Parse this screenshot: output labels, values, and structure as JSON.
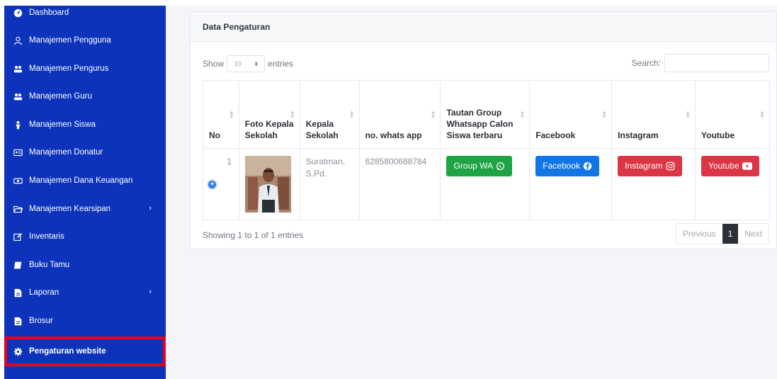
{
  "sidebar": {
    "items": [
      {
        "label": "Dashboard",
        "icon": "dashboard-icon"
      },
      {
        "label": "Manajemen Pengguna",
        "icon": "user-icon"
      },
      {
        "label": "Manajemen Pengurus",
        "icon": "users-icon"
      },
      {
        "label": "Manajemen Guru",
        "icon": "users-icon"
      },
      {
        "label": "Manajemen Siswa",
        "icon": "student-icon"
      },
      {
        "label": "Manajemen Donatur",
        "icon": "id-card-icon"
      },
      {
        "label": "Manajemen Dana Keuangan",
        "icon": "money-icon"
      },
      {
        "label": "Manajemen Kearsipan",
        "icon": "folder-open-icon",
        "chevron": "›"
      },
      {
        "label": "Inventaris",
        "icon": "edit-icon"
      },
      {
        "label": "Buku Tamu",
        "icon": "book-icon"
      },
      {
        "label": "Laporan",
        "icon": "file-icon",
        "chevron": "›"
      },
      {
        "label": "Brosur",
        "icon": "file-icon"
      },
      {
        "label": "Pengaturan website",
        "icon": "gear-icon"
      }
    ],
    "active_index": 12,
    "bg_color": "#0c33b9",
    "highlight_color": "#e8001c"
  },
  "card": {
    "title": "Data Pengaturan"
  },
  "controls": {
    "show_label": "Show",
    "page_length": "10",
    "entries_label": "entries",
    "search_label": "Search:"
  },
  "table": {
    "columns": [
      "No",
      "Foto Kepala Sekolah",
      "Kepala Sekolah",
      "no. whats app",
      "Tautan Group Whatsapp Calon Siswa terbaru",
      "Facebook",
      "Instagram",
      "Youtube"
    ],
    "rows": [
      {
        "no": "1",
        "kepala_sekolah": "Suratman, S.Pd.",
        "whatsapp": "6285800688784",
        "group_wa_label": "Group WA",
        "facebook_label": "Facebook",
        "instagram_label": "Instagram",
        "youtube_label": "Youtube"
      }
    ]
  },
  "footer": {
    "info": "Showing 1 to 1 of 1 entries",
    "previous": "Previous",
    "current_page": "1",
    "next": "Next"
  },
  "colors": {
    "whatsapp": "#1ea345",
    "facebook": "#1275e6",
    "instagram": "#dc3545",
    "youtube": "#dc3545"
  }
}
